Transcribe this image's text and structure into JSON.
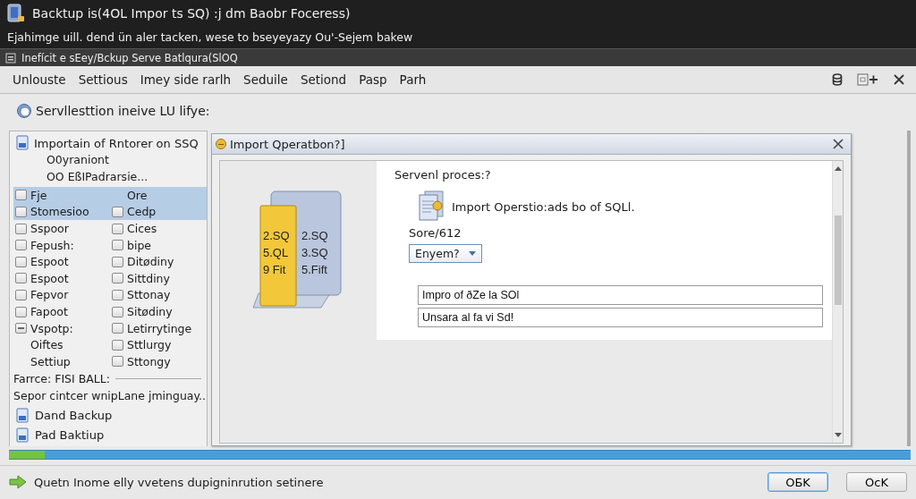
{
  "app": {
    "title": "Backtup is(4OL Impor ts SQ) :j dm Baobr Foceress)",
    "subtitle": "Ejahimge uill. dend ün aler tacken, wese to bseyeyazy Ou'-Sejem bakew"
  },
  "window": {
    "title": "Inefícit e sEey/Bckup Serve Batlqura(SlOQ"
  },
  "menu": [
    {
      "label": "Unlouste"
    },
    {
      "label": "Settious"
    },
    {
      "label": "Imey side rarlh"
    },
    {
      "label": "Seduile"
    },
    {
      "label": "Setiond"
    },
    {
      "label": "Pasp"
    },
    {
      "label": "Parh"
    }
  ],
  "heading": "Servllesttion ineive LU lifye:",
  "tree": {
    "title": "Importain of Rntorer on SSQ",
    "children": [
      {
        "label": "O0yraniont"
      },
      {
        "label": "OO EßIPadrarsie..."
      }
    ]
  },
  "options": [
    {
      "selected": true,
      "left": {
        "kind": "checkbox",
        "label": "Fje",
        "indeterminate": false
      },
      "right": {
        "kind": "label",
        "label": "Ore"
      }
    },
    {
      "selected": true,
      "left": {
        "kind": "checkbox",
        "label": "Stomesioo",
        "indeterminate": false
      },
      "right": {
        "kind": "checkbox",
        "label": "Cedp",
        "indeterminate": false
      }
    },
    {
      "selected": false,
      "left": {
        "kind": "checkbox",
        "label": "Sspoor",
        "indeterminate": false
      },
      "right": {
        "kind": "checkbox",
        "label": "Cices",
        "indeterminate": false
      }
    },
    {
      "selected": false,
      "left": {
        "kind": "checkbox",
        "label": "Fepush:",
        "indeterminate": false
      },
      "right": {
        "kind": "checkbox",
        "label": "bipe",
        "indeterminate": false
      }
    },
    {
      "selected": false,
      "left": {
        "kind": "checkbox",
        "label": "Espoot",
        "indeterminate": false
      },
      "right": {
        "kind": "checkbox",
        "label": "Ditødiny",
        "indeterminate": false
      }
    },
    {
      "selected": false,
      "left": {
        "kind": "checkbox",
        "label": "Espoot",
        "indeterminate": false
      },
      "right": {
        "kind": "checkbox",
        "label": "Sittdiny",
        "indeterminate": false
      }
    },
    {
      "selected": false,
      "left": {
        "kind": "checkbox",
        "label": "Fepvor",
        "indeterminate": false
      },
      "right": {
        "kind": "checkbox",
        "label": "Sttonay",
        "indeterminate": false
      }
    },
    {
      "selected": false,
      "left": {
        "kind": "checkbox",
        "label": "Fapoot",
        "indeterminate": false
      },
      "right": {
        "kind": "checkbox",
        "label": "Sitødiny",
        "indeterminate": false
      }
    },
    {
      "selected": false,
      "left": {
        "kind": "checkbox",
        "label": "Vspotp:",
        "indeterminate": true
      },
      "right": {
        "kind": "checkbox",
        "label": "Letirrytinge",
        "indeterminate": false
      }
    },
    {
      "selected": false,
      "left": {
        "kind": "label",
        "label": "Oiftes"
      },
      "right": {
        "kind": "checkbox",
        "label": "Sttlurgy",
        "indeterminate": false
      }
    },
    {
      "selected": false,
      "left": {
        "kind": "label",
        "label": "Settiup"
      },
      "right": {
        "kind": "checkbox",
        "label": "Sttongy",
        "indeterminate": false
      }
    }
  ],
  "group": {
    "title": "Farrce: FISI BALL:",
    "description": "Sepor cintcer wnipLane jminguay..",
    "items": [
      {
        "label": "Dand Backup"
      },
      {
        "label": "Pad Baktiup"
      }
    ]
  },
  "dialog": {
    "title": "Import Qperatbon?]",
    "illustration": {
      "front": [
        "2.SQ",
        "5.QL",
        "9 Fit"
      ],
      "back": [
        "2.SQ",
        "3.SQ",
        "5.Fift"
      ]
    },
    "heading": "Servenl proces:?",
    "info": "Import Operstio:ads bo of SQLl.",
    "field_label": "Sore/612",
    "dropdown": {
      "value": "Enyem?"
    },
    "fields": [
      {
        "value": "Impro of ðZe la SOl"
      },
      {
        "value": "Unsara al fa vi Sd!"
      }
    ]
  },
  "progress": {
    "level": 0.04
  },
  "status": {
    "text": "Quetn Inome elly vvetens dupigninrution setinere"
  },
  "buttons": [
    {
      "label": "OБK",
      "default": true
    },
    {
      "label": "OcK",
      "default": false
    }
  ]
}
